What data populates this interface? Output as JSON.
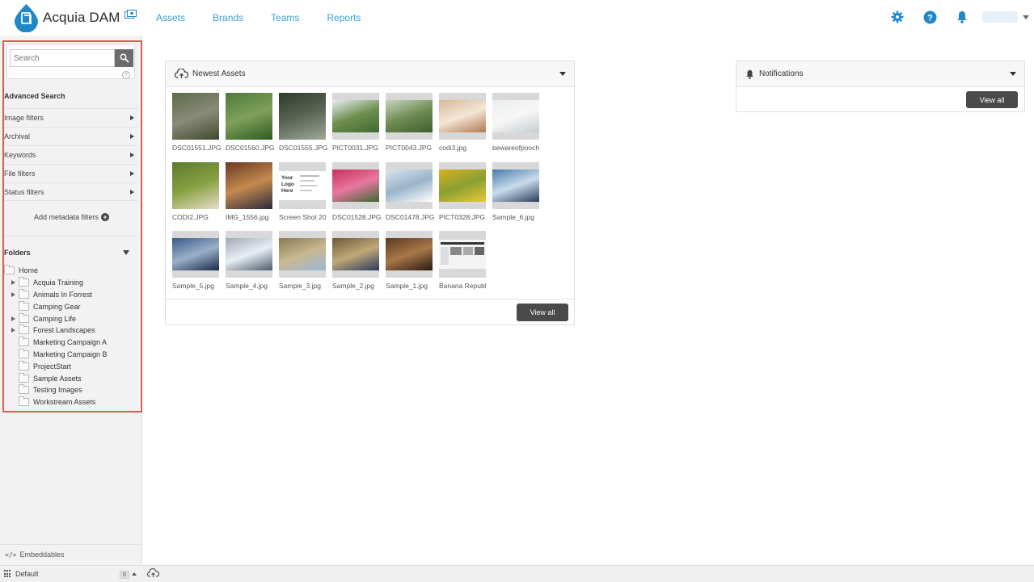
{
  "header": {
    "app_name": "Acquia DAM",
    "nav": [
      "Assets",
      "Brands",
      "Teams",
      "Reports"
    ],
    "colors": {
      "accent": "#3aa0d0",
      "brand": "#1e88c8"
    }
  },
  "sidebar": {
    "search": {
      "placeholder": "Search"
    },
    "advanced_search": "Advanced Search",
    "filters": [
      "Image filters",
      "Archival",
      "Keywords",
      "File filters",
      "Status filters"
    ],
    "add_metadata": "Add metadata filters",
    "folders_title": "Folders",
    "folders": [
      {
        "label": "Home",
        "expandable": false,
        "indent": 0
      },
      {
        "label": "Acquia Training",
        "expandable": true,
        "indent": 1
      },
      {
        "label": "Animals In Forrest",
        "expandable": true,
        "indent": 1
      },
      {
        "label": "Camping Gear",
        "expandable": false,
        "indent": 1
      },
      {
        "label": "Camping Life",
        "expandable": true,
        "indent": 1
      },
      {
        "label": "Forest Landscapes",
        "expandable": true,
        "indent": 1
      },
      {
        "label": "Marketing Campaign A",
        "expandable": false,
        "indent": 1
      },
      {
        "label": "Marketing Campaign B",
        "expandable": false,
        "indent": 1
      },
      {
        "label": "ProjectStart",
        "expandable": false,
        "indent": 1
      },
      {
        "label": "Sample Assets",
        "expandable": false,
        "indent": 1
      },
      {
        "label": "Testing Images",
        "expandable": false,
        "indent": 1
      },
      {
        "label": "Workstream Assets",
        "expandable": false,
        "indent": 1
      }
    ],
    "embeddables": "Embeddables"
  },
  "statusbar": {
    "view_label": "Default",
    "count": "0"
  },
  "newest_assets": {
    "title": "Newest Assets",
    "view_all": "View all",
    "items": [
      {
        "label": "DSC01551.JPG",
        "colors": [
          "#5a6b45",
          "#8a8a7a",
          "#3d4a2c"
        ]
      },
      {
        "label": "DSC01560.JPG",
        "colors": [
          "#4d7a3a",
          "#7fa05a",
          "#2d5a22"
        ]
      },
      {
        "label": "DSC01555.JPG",
        "colors": [
          "#2e3a2a",
          "#5b6655",
          "#a0a89a"
        ]
      },
      {
        "label": "PICT0031.JPG",
        "colors": [
          "#e8eef2",
          "#6e8f4e",
          "#3f6a32"
        ]
      },
      {
        "label": "PICT0043.JPG",
        "colors": [
          "#c9d4c0",
          "#6e8c52",
          "#3e5e30"
        ]
      },
      {
        "label": "codi3.jpg",
        "colors": [
          "#d9b89a",
          "#f2e6d6",
          "#b07850"
        ]
      },
      {
        "label": "bewareofpooch",
        "colors": [
          "#e9edf0",
          "#f7f7f5",
          "#c5ccd2"
        ]
      },
      {
        "label": "CODI2.JPG",
        "colors": [
          "#5c7a2e",
          "#86a040",
          "#e8dcc8"
        ]
      },
      {
        "label": "IMG_1556.jpg",
        "colors": [
          "#6a3a22",
          "#c48a50",
          "#2a2a3a"
        ]
      },
      {
        "label": "Screen Shot 20",
        "colors": [
          "#ffffff",
          "#eeeeee",
          "#cccccc"
        ]
      },
      {
        "label": "DSC01528.JPG",
        "colors": [
          "#c8305a",
          "#e878a0",
          "#3a6a30"
        ]
      },
      {
        "label": "DSC01478.JPG",
        "colors": [
          "#d8e4ee",
          "#9ab4c8",
          "#ffffff"
        ]
      },
      {
        "label": "PICT0328.JPG",
        "colors": [
          "#d8b020",
          "#8aa030",
          "#e8c83a"
        ]
      },
      {
        "label": "Sample_6.jpg",
        "colors": [
          "#4a7aa8",
          "#c8dcec",
          "#2a3a5a"
        ]
      },
      {
        "label": "Sample_5.jpg",
        "colors": [
          "#3a5a8a",
          "#9ab0c8",
          "#1a2a4a"
        ]
      },
      {
        "label": "Sample_4.jpg",
        "colors": [
          "#a0aab8",
          "#e8eef4",
          "#4a5a6a"
        ]
      },
      {
        "label": "Sample_3.jpg",
        "colors": [
          "#8a7a52",
          "#c8b890",
          "#9ab8d8"
        ]
      },
      {
        "label": "Sample_2.jpg",
        "colors": [
          "#6a5a3a",
          "#c0a878",
          "#2a3a5a"
        ]
      },
      {
        "label": "Sample_1.jpg",
        "colors": [
          "#5a3a22",
          "#a87848",
          "#2a1a12"
        ]
      },
      {
        "label": "Banana Republ",
        "colors": [
          "#f4f4f4",
          "#333333",
          "#dddddd"
        ]
      }
    ]
  },
  "notifications": {
    "title": "Notifications",
    "view_all": "View all"
  }
}
